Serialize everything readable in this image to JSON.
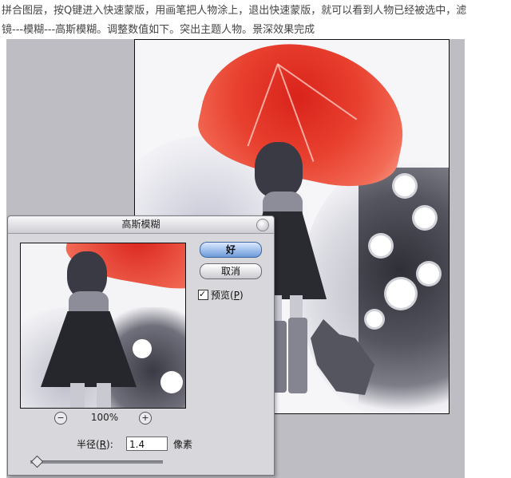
{
  "caption": {
    "line1": "拼合图层，按Q键进入快速蒙版，用画笔把人物涂上，退出快速蒙版，就可以看到人物已经被选中，滤",
    "line2": "镜---模糊---高斯模糊。调整数值如下。突出主题人物。景深效果完成"
  },
  "dialog": {
    "title": "高斯模糊",
    "ok_label": "好",
    "cancel_label": "取消",
    "preview_label_prefix": "预览(",
    "preview_label_key": "P",
    "preview_label_suffix": ")",
    "preview_checked": true,
    "zoom_minus_label": "−",
    "zoom_plus_label": "+",
    "zoom_level": "100%",
    "radius_label_prefix": "半径(",
    "radius_label_key": "R",
    "radius_label_suffix": "):",
    "radius_value": "1.4",
    "radius_unit": "像素",
    "radius_slider_fraction": 0.04
  },
  "icons": {
    "close": "close-icon",
    "checkbox": "checkmark-icon",
    "slider_knob": "slider-thumb-icon"
  },
  "colors": {
    "umbrella_red": "#e8402f",
    "ok_button_blue": "#6c9ad9",
    "workspace_gray": "#bdbdc3"
  }
}
